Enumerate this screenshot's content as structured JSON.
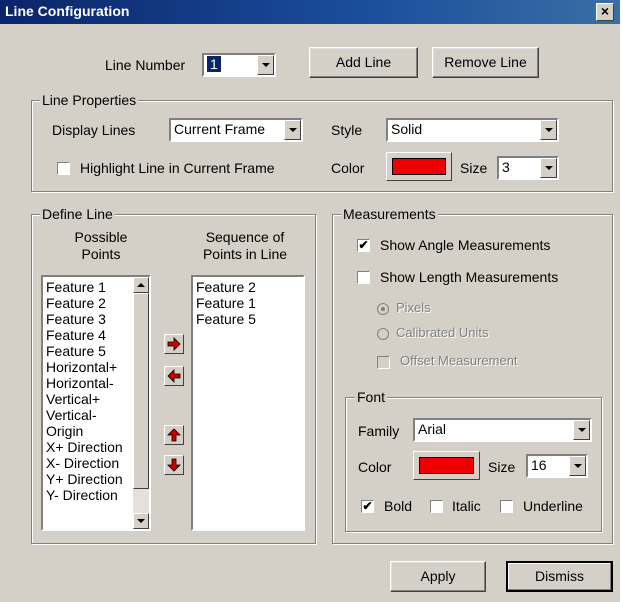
{
  "window": {
    "title": "Line Configuration",
    "close_glyph": "×"
  },
  "top": {
    "line_number_label": "Line Number",
    "line_number_value": "1",
    "add_line": "Add Line",
    "remove_line": "Remove Line"
  },
  "line_properties": {
    "legend": "Line Properties",
    "display_lines_label": "Display Lines",
    "display_lines_value": "Current Frame",
    "style_label": "Style",
    "style_value": "Solid",
    "highlight_label": "Highlight Line in Current Frame",
    "highlight_checked": false,
    "color_label": "Color",
    "color": "#ee0000",
    "size_label": "Size",
    "size_value": "3"
  },
  "define_line": {
    "legend": "Define Line",
    "possible_header": "Possible\nPoints",
    "sequence_header": "Sequence of\nPoints in Line",
    "possible_points": [
      "Feature 1",
      "Feature 2",
      "Feature 3",
      "Feature 4",
      "Feature 5",
      "Horizontal+",
      "Horizontal-",
      "Vertical+",
      "Vertical-",
      "Origin",
      "X+ Direction",
      "X- Direction",
      "Y+ Direction",
      "Y- Direction"
    ],
    "sequence_points": [
      "Feature 2",
      "Feature 1",
      "Feature 5"
    ],
    "arrow_color": "#cc0000"
  },
  "measurements": {
    "legend": "Measurements",
    "show_angle": "Show Angle Measurements",
    "show_angle_checked": true,
    "show_length": "Show Length Measurements",
    "show_length_checked": false,
    "pixels": "Pixels",
    "calibrated": "Calibrated Units",
    "offset": "Offset Measurement"
  },
  "font": {
    "legend": "Font",
    "family_label": "Family",
    "family_value": "Arial",
    "color_label": "Color",
    "color": "#ee0000",
    "size_label": "Size",
    "size_value": "16",
    "bold": "Bold",
    "bold_checked": true,
    "italic": "Italic",
    "italic_checked": false,
    "underline": "Underline",
    "underline_checked": false
  },
  "buttons": {
    "apply": "Apply",
    "dismiss": "Dismiss"
  }
}
